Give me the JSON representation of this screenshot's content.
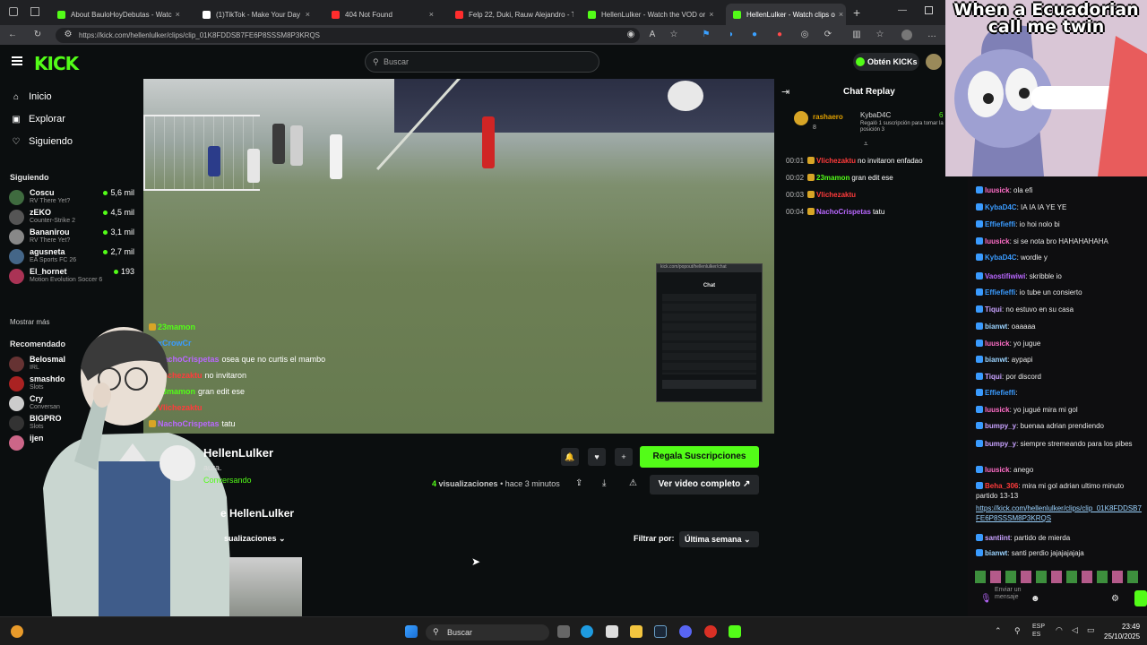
{
  "browser": {
    "tabs": [
      {
        "label": "About BauloHoyDebutas - Watc",
        "color": "#53fc18"
      },
      {
        "label": "(1)TikTok - Make Your Day",
        "color": "#ffffff"
      },
      {
        "label": "404 Not Found",
        "color": "#ff2d2d"
      },
      {
        "label": "Felp 22, Duki, Rauw Alejandro - T",
        "color": "#ff2d2d"
      },
      {
        "label": "HellenLulker - Watch the VOD or",
        "color": "#53fc18"
      },
      {
        "label": "HellenLulker - Watch clips o",
        "color": "#53fc18"
      }
    ],
    "url": "https://kick.com/hellenlulker/clips/clip_01K8FDDSB7FE6P8SSSM8P3KRQS"
  },
  "kick": {
    "logo": "KICK",
    "search_placeholder": "Buscar",
    "get_kicks": "Obtén KICKs",
    "nav": [
      {
        "label": "Inicio",
        "icon": "home-icon",
        "glyph": "⌂"
      },
      {
        "label": "Explorar",
        "icon": "compass-icon",
        "glyph": "▣"
      },
      {
        "label": "Siguiendo",
        "icon": "heart-icon",
        "glyph": "♡"
      }
    ],
    "following_title": "Siguiendo",
    "following": [
      {
        "name": "Coscu",
        "game": "RV There Yet?",
        "viewers": "5,6 mil",
        "color": "#3f6b3f"
      },
      {
        "name": "zEKO",
        "game": "Counter-Strike 2",
        "viewers": "4,5 mil",
        "color": "#555555"
      },
      {
        "name": "Bananirou",
        "game": "RV There Yet?",
        "viewers": "3,1 mil",
        "color": "#888888"
      },
      {
        "name": "agusneta",
        "game": "EA Sports FC 26",
        "viewers": "2,7 mil",
        "color": "#446688"
      },
      {
        "name": "El_hornet",
        "game": "Motion Evolution Soccer 6",
        "viewers": "193",
        "color": "#aa3355"
      }
    ],
    "show_more": "Mostrar más",
    "recommended_title": "Recomendado",
    "recommended": [
      {
        "name": "Belosmal",
        "game": "IRL",
        "color": "#663333"
      },
      {
        "name": "smashdo",
        "game": "Slots",
        "color": "#aa2222"
      },
      {
        "name": "Cry",
        "game": "Conversan",
        "color": "#cccccc"
      },
      {
        "name": "BIGPRO",
        "game": "Slots",
        "color": "#333333"
      },
      {
        "name": "ijen",
        "game": "",
        "color": "#cc6688"
      }
    ],
    "overlay_chat": [
      {
        "user": "23mamon",
        "text": "",
        "color": "#53fc18"
      },
      {
        "user": "xCrowCr",
        "text": "",
        "color": "#3a9bff"
      },
      {
        "user": "NachoCrispetas",
        "text": "osea que no curtis el mambo",
        "color": "#b967ff"
      },
      {
        "user": "Vlichezaktu",
        "text": "no invitaron",
        "color": "#ff3b3b"
      },
      {
        "user": "23mamon",
        "text": "gran edit ese",
        "color": "#53fc18"
      },
      {
        "user": "Vlichezaktu",
        "text": "",
        "color": "#ff3b3b"
      },
      {
        "user": "NachoCrispetas",
        "text": "tatu",
        "color": "#b967ff"
      }
    ],
    "minichat_title": "Chat",
    "streamer": "HellenLulker",
    "bio": "aura.",
    "category": "Conversando",
    "gift_button": "Regala Suscripciones",
    "views_count": "4",
    "views_label": "visualizaciones",
    "time_ago": "• hace 3 minutos",
    "full_video_button": "Ver video completo",
    "clips_title": "e HellenLulker",
    "sort_label": "sualizaciones",
    "filter_label": "Filtrar por:",
    "filter_value": "Última semana"
  },
  "replay": {
    "title": "Chat Replay",
    "pinned_user": "rashaero",
    "pinned_count": "8",
    "gifter": "KybaD4C",
    "gifter_note": "Regaló 1 suscripción para tomar la posición 3",
    "gifter_count": "6",
    "lines": [
      {
        "time": "00:01",
        "user": "Vlichezaktu",
        "text": "no invitaron enfadao",
        "color": "#ff3b3b"
      },
      {
        "time": "00:02",
        "user": "23mamon",
        "text": "gran edit ese",
        "color": "#53fc18"
      },
      {
        "time": "00:03",
        "user": "Vlichezaktu",
        "text": "",
        "color": "#ff3b3b"
      },
      {
        "time": "00:04",
        "user": "NachoCrispetas",
        "text": "tatu",
        "color": "#b967ff"
      }
    ]
  },
  "meme": {
    "text": "When a Ecuadorian call me twin"
  },
  "side_chat": {
    "lines": [
      {
        "user": "luusick",
        "text": "ola efi",
        "color": "#ff6ec7"
      },
      {
        "user": "KybaD4C",
        "text": "IA IA IA YE YE",
        "color": "#3a9bff"
      },
      {
        "user": "Effiefieffi",
        "text": "io hoi nolo bi",
        "color": "#3a9bff"
      },
      {
        "user": "luusick",
        "text": "si se nota bro HAHAHAHAHA",
        "color": "#ff6ec7"
      },
      {
        "user": "KybaD4C",
        "text": "wordle y",
        "color": "#3a9bff"
      },
      {
        "user": "Vaostifiwiwi",
        "text": "skribble io",
        "color": "#b967ff"
      },
      {
        "user": "Effiefieffi",
        "text": "io tube un consierto",
        "color": "#3a9bff"
      },
      {
        "user": "Tiqui",
        "text": "no estuvo en su casa",
        "color": "#c8a2ff"
      },
      {
        "user": "bianwt",
        "text": "oaaaaa",
        "color": "#9bd3ff"
      },
      {
        "user": "luusick",
        "text": "yo jugue",
        "color": "#ff6ec7"
      },
      {
        "user": "bianwt",
        "text": "aypapi",
        "color": "#9bd3ff"
      },
      {
        "user": "Tiqui",
        "text": "por discord",
        "color": "#c8a2ff"
      },
      {
        "user": "Effiefieffi",
        "text": "",
        "color": "#3a9bff"
      },
      {
        "user": "luusick",
        "text": "yo jugué mira mi gol",
        "color": "#ff6ec7"
      },
      {
        "user": "bumpy_y",
        "text": "buenaa adrian prendiendo",
        "color": "#c8a2ff"
      },
      {
        "user": "bumpy_y",
        "text": "siempre stremeando para los pibes",
        "color": "#c8a2ff"
      },
      {
        "user": "luusick",
        "text": "anego",
        "color": "#ff6ec7"
      },
      {
        "user": "Beha_306",
        "text": "mira mi gol adrian ultimo minuto partido 13-13",
        "color": "#ff3b3b"
      },
      {
        "user": "",
        "text": "https://kick.com/hellenlulker/clips/clip_01K8FDDSB7FE6P8SSSM8P3KRQS",
        "color": "#9bd3ff"
      },
      {
        "user": "santiint",
        "text": "partido de mierda",
        "color": "#c8a2ff"
      },
      {
        "user": "bianwt",
        "text": "santi perdio jajajajajaja",
        "color": "#9bd3ff"
      }
    ],
    "send_label": "Enviar un mensaje"
  },
  "taskbar": {
    "search": "Buscar",
    "lang": "ESP",
    "lang2": "ES",
    "time": "23:49",
    "date": "25/10/2025"
  }
}
